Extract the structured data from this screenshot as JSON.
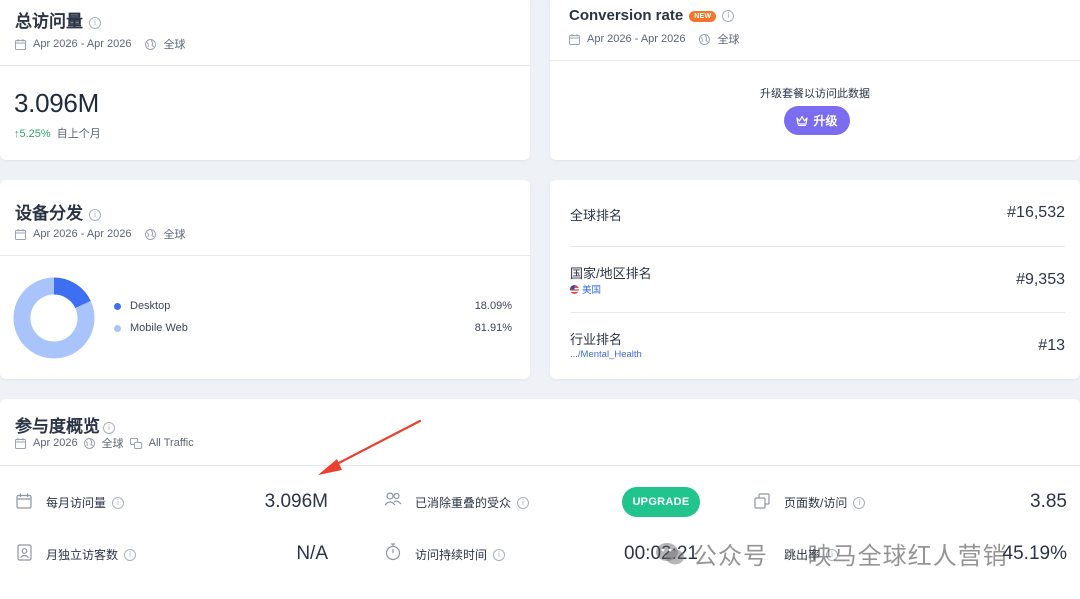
{
  "total_visits": {
    "title": "总访问量",
    "date_range": "Apr 2026 - Apr 2026",
    "region": "全球",
    "value": "3.096M",
    "delta_pct": "5.25%",
    "delta_label": "自上个月"
  },
  "conversion": {
    "title": "Conversion rate",
    "badge": "NEW",
    "date_range": "Apr 2026 - Apr 2026",
    "region": "全球",
    "upgrade_hint": "升级套餐以访问此数据",
    "upgrade_label": "升级"
  },
  "device": {
    "title": "设备分发",
    "date_range": "Apr 2026 - Apr 2026",
    "region": "全球",
    "items": [
      {
        "label": "Desktop",
        "pct": "18.09%",
        "value": 18.09,
        "color": "#3e6ff2"
      },
      {
        "label": "Mobile Web",
        "pct": "81.91%",
        "value": 81.91,
        "color": "#a9c4fb"
      }
    ]
  },
  "ranks": {
    "global_label": "全球排名",
    "global_value": "#16,532",
    "country_label": "国家/地区排名",
    "country_sub": "美国",
    "country_value": "#9,353",
    "industry_label": "行业排名",
    "industry_sub": ".../Mental_Health",
    "industry_value": "#13"
  },
  "engagement": {
    "title": "参与度概览",
    "date": "Apr 2026",
    "region": "全球",
    "traffic": "All Traffic",
    "monthly_visits_label": "每月访问量",
    "monthly_visits_value": "3.096M",
    "dedup_label": "已消除重叠的受众",
    "dedup_button": "UPGRADE",
    "pages_label": "页面数/访问",
    "pages_value": "3.85",
    "unique_label": "月独立访客数",
    "unique_value": "N/A",
    "duration_label": "访问持续时间",
    "duration_value": "00:02:21",
    "bounce_label": "跳出率",
    "bounce_value": "45.19%"
  },
  "watermark": {
    "account": "公众号",
    "name": "映马全球红人营销"
  },
  "colors": {
    "accent_purple": "#7b6cf0",
    "accent_green": "#21c48d",
    "badge_orange": "#f2762e",
    "positive": "#2ba86b",
    "link": "#3c6be0",
    "arrow": "#e8412f"
  }
}
